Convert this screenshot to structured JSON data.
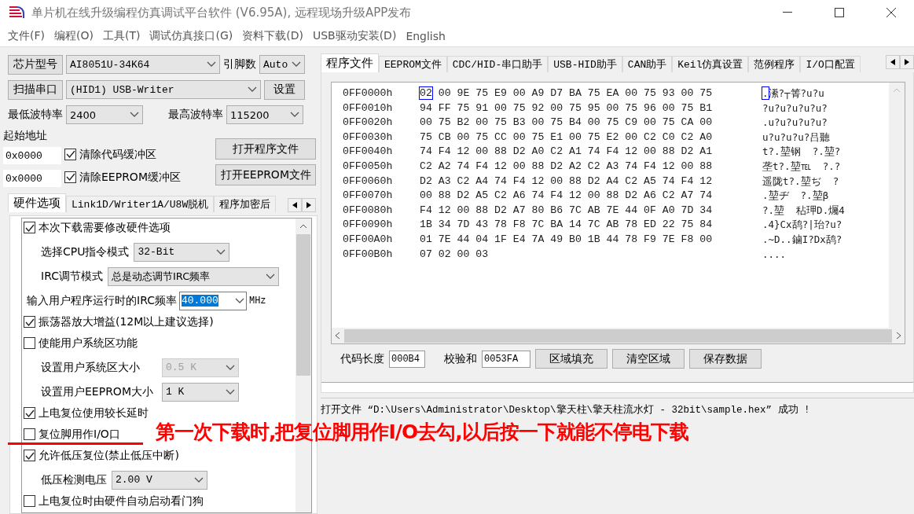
{
  "window": {
    "title": "单片机在线升级编程仿真调试平台软件 (V6.95A), 远程现场升级APP发布"
  },
  "menu": [
    "文件(F)",
    "编程(O)",
    "工具(T)",
    "调试仿真接口(G)",
    "资料下载(D)",
    "USB驱动安装(D)",
    "English"
  ],
  "chip": {
    "button": "芯片型号",
    "value": "AI8051U-34K64",
    "pins_label": "引脚数",
    "pins_value": "Auto"
  },
  "port": {
    "button": "扫描串口",
    "value": "(HID1) USB-Writer",
    "settings_button": "设置"
  },
  "baud": {
    "min_label": "最低波特率",
    "min_value": "2400",
    "max_label": "最高波特率",
    "max_value": "115200"
  },
  "start_address": {
    "label": "起始地址",
    "code_address": "0x0000",
    "eeprom_address": "0x0000"
  },
  "clear_options": [
    {
      "label": "清除代码缓冲区",
      "checked": true
    },
    {
      "label": "清除EEPROM缓冲区",
      "checked": true
    }
  ],
  "open_buttons": [
    "打开程序文件",
    "打开EEPROM文件"
  ],
  "left_tabs": [
    {
      "label": "硬件选项",
      "selected": true
    },
    {
      "label": "Link1D/Writer1A/U8W脱机",
      "selected": false
    },
    {
      "label": "程序加密后",
      "selected": false
    }
  ],
  "hardware_options": [
    {
      "kind": "checkbox",
      "label": "本次下载需要修改硬件选项",
      "checked": true
    },
    {
      "kind": "select",
      "label": "选择CPU指令模式",
      "value": "32-Bit",
      "disabled": false
    },
    {
      "kind": "wideselect",
      "label": "IRC调节模式",
      "value": "总是动态调节IRC频率",
      "disabled": false
    },
    {
      "kind": "combo",
      "label": "输入用户程序运行时的IRC频率",
      "value": "40.000",
      "unit": "MHz"
    },
    {
      "kind": "checkbox",
      "label": "振荡器放大增益(12M以上建议选择)",
      "checked": true
    },
    {
      "kind": "checkbox",
      "label": "使能用户系统区功能",
      "checked": false
    },
    {
      "kind": "sizeselect",
      "label": "设置用户系统区大小",
      "value": "0.5 K",
      "disabled": true
    },
    {
      "kind": "sizeselect",
      "label": "设置用户EEPROM大小",
      "value": "1    K",
      "disabled": false
    },
    {
      "kind": "checkbox",
      "label": "上电复位使用较长延时",
      "checked": true
    },
    {
      "kind": "checkbox",
      "label": "复位脚用作I/O口",
      "checked": false
    },
    {
      "kind": "checkbox",
      "label": "允许低压复位(禁止低压中断)",
      "checked": true
    },
    {
      "kind": "select",
      "label": "低压检测电压",
      "value": "2.00 V",
      "disabled": false
    },
    {
      "kind": "checkbox",
      "label": "上电复位时由硬件自动启动看门狗",
      "checked": false
    }
  ],
  "right_tabs": [
    {
      "label": "程序文件",
      "selected": true
    },
    {
      "label": "EEPROM文件",
      "selected": false
    },
    {
      "label": "CDC/HID-串口助手",
      "selected": false
    },
    {
      "label": "USB-HID助手",
      "selected": false
    },
    {
      "label": "CAN助手",
      "selected": false
    },
    {
      "label": "Keil仿真设置",
      "selected": false
    },
    {
      "label": "范例程序",
      "selected": false
    },
    {
      "label": "I/O口配置",
      "selected": false
    }
  ],
  "hex_rows": [
    {
      "address": "0FF0000h",
      "bytes": [
        "02",
        "00",
        "9E",
        "75",
        "E9",
        "00",
        "A9",
        "D7",
        "BA",
        "75",
        "EA",
        "00",
        "75",
        "93",
        "00",
        "75"
      ],
      "ascii": ".潫?┬箐?u?u",
      "cursor": true
    },
    {
      "address": "0FF0010h",
      "bytes": [
        "94",
        "FF",
        "75",
        "91",
        "00",
        "75",
        "92",
        "00",
        "75",
        "95",
        "00",
        "75",
        "96",
        "00",
        "75",
        "B1"
      ],
      "ascii": "?u?u?u?u?u?",
      "cursor": false
    },
    {
      "address": "0FF0020h",
      "bytes": [
        "00",
        "75",
        "B2",
        "00",
        "75",
        "B3",
        "00",
        "75",
        "B4",
        "00",
        "75",
        "C9",
        "00",
        "75",
        "CA",
        "00"
      ],
      "ascii": ".u?u?u?u?u?",
      "cursor": false
    },
    {
      "address": "0FF0030h",
      "bytes": [
        "75",
        "CB",
        "00",
        "75",
        "CC",
        "00",
        "75",
        "E1",
        "00",
        "75",
        "E2",
        "00",
        "C2",
        "C0",
        "C2",
        "A0"
      ],
      "ascii": "u?u?u?u?吕聽",
      "cursor": false
    },
    {
      "address": "0FF0040h",
      "bytes": [
        "74",
        "F4",
        "12",
        "00",
        "88",
        "D2",
        "A0",
        "C2",
        "A1",
        "74",
        "F4",
        "12",
        "00",
        "88",
        "D2",
        "A1"
      ],
      "ascii": "t?.堃钢  ?.堃?",
      "cursor": false
    },
    {
      "address": "0FF0050h",
      "bytes": [
        "C2",
        "A2",
        "74",
        "F4",
        "12",
        "00",
        "88",
        "D2",
        "A2",
        "C2",
        "A3",
        "74",
        "F4",
        "12",
        "00",
        "88"
      ],
      "ascii": "垄t?.堃℡  ?.?",
      "cursor": false
    },
    {
      "address": "0FF0060h",
      "bytes": [
        "D2",
        "A3",
        "C2",
        "A4",
        "74",
        "F4",
        "12",
        "00",
        "88",
        "D2",
        "A4",
        "C2",
        "A5",
        "74",
        "F4",
        "12"
      ],
      "ascii": "遥陇t?.堃ぢ  ?",
      "cursor": false
    },
    {
      "address": "0FF0070h",
      "bytes": [
        "00",
        "88",
        "D2",
        "A5",
        "C2",
        "A6",
        "74",
        "F4",
        "12",
        "00",
        "88",
        "D2",
        "A6",
        "C2",
        "A7",
        "74"
      ],
      "ascii": ".堃ヂ  ?.堃β",
      "cursor": false
    },
    {
      "address": "0FF0080h",
      "bytes": [
        "F4",
        "12",
        "00",
        "88",
        "D2",
        "A7",
        "80",
        "B6",
        "7C",
        "AB",
        "7E",
        "44",
        "0F",
        "A0",
        "7D",
        "34"
      ],
      "ascii": "?.堃  秥玾D.爥4",
      "cursor": false
    },
    {
      "address": "0FF0090h",
      "bytes": [
        "1B",
        "34",
        "7D",
        "43",
        "78",
        "F8",
        "7C",
        "BA",
        "14",
        "7C",
        "AB",
        "78",
        "ED",
        "22",
        "75",
        "84"
      ],
      "ascii": ".4}Cx鸹?|珆?u?",
      "cursor": false
    },
    {
      "address": "0FF00A0h",
      "bytes": [
        "01",
        "7E",
        "44",
        "04",
        "1F",
        "E4",
        "7A",
        "49",
        "B0",
        "1B",
        "44",
        "78",
        "F9",
        "7E",
        "F8",
        "00"
      ],
      "ascii": ".~D..鏀I?Dx鸹?",
      "cursor": false
    },
    {
      "address": "0FF00B0h",
      "bytes": [
        "07",
        "02",
        "00",
        "03"
      ],
      "ascii": "....",
      "cursor": false
    }
  ],
  "code_info": {
    "length_label": "代码长度",
    "length_value": "000B4",
    "checksum_label": "校验和",
    "checksum_value": "0053FA"
  },
  "hex_buttons": [
    "区域填充",
    "清空区域",
    "保存数据"
  ],
  "log": "打开文件 “D:\\Users\\Administrator\\Desktop\\擎天柱\\擎天柱流水灯 - 32bit\\sample.hex” 成功 !",
  "annotation": "第一次下载时,把复位脚用作I/O去勾,以后按一下就能不停电下载"
}
